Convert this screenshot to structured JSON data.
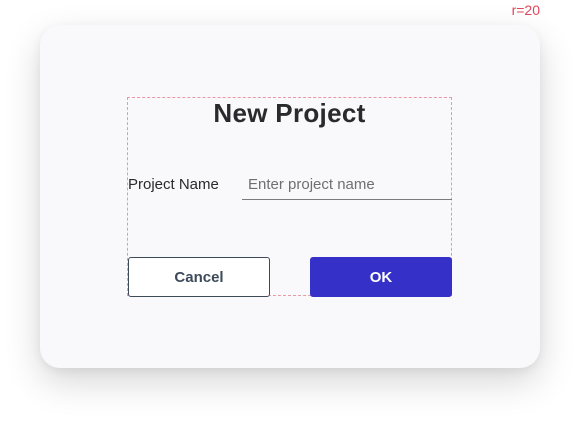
{
  "annotation": {
    "radius_label": "r=20"
  },
  "dialog": {
    "title": "New Project",
    "field": {
      "label": "Project Name",
      "value": "",
      "placeholder": "Enter project name"
    },
    "buttons": {
      "cancel_label": "Cancel",
      "ok_label": "OK"
    }
  },
  "colors": {
    "primary": "#3430c8",
    "annotation": "#e0475b",
    "dialog_background": "#f9f8fb",
    "cancel_border": "#3d4a5a"
  }
}
